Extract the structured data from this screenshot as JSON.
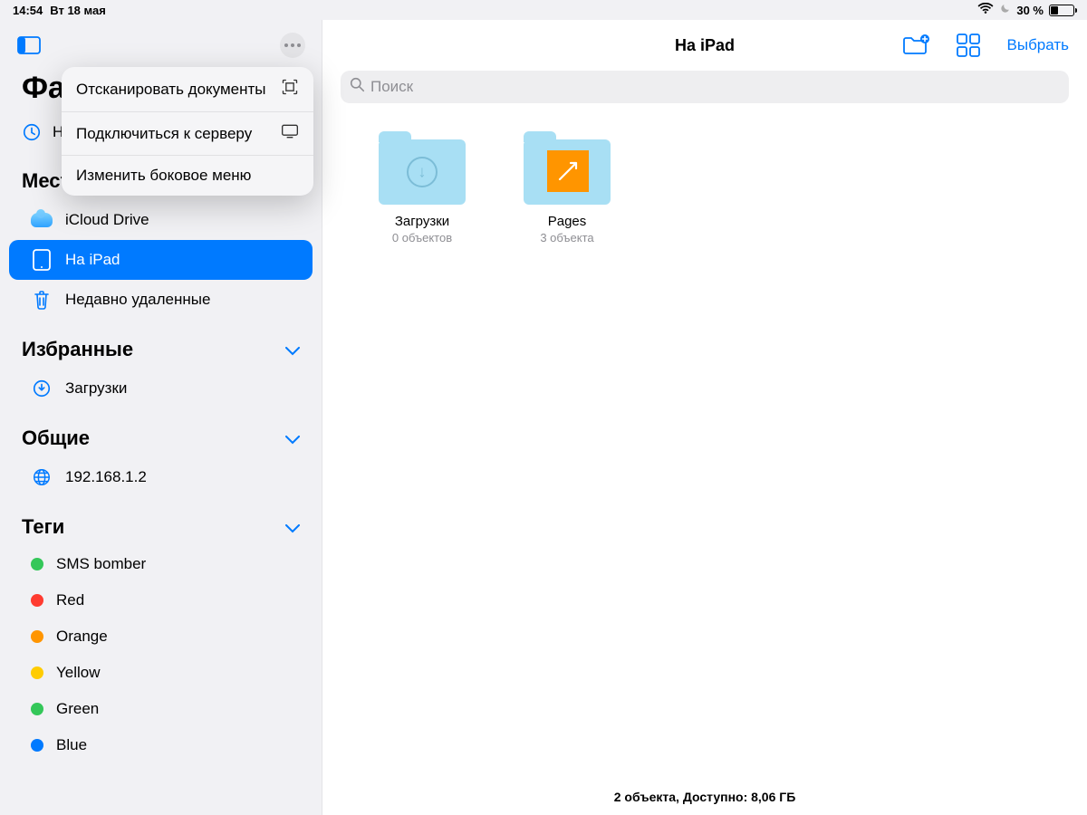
{
  "statusbar": {
    "time": "14:54",
    "date": "Вт 18 мая",
    "battery": "30 %"
  },
  "sidebar": {
    "title": "Файлы",
    "recent_label": "Недавние",
    "sections": {
      "places": {
        "title": "Места",
        "items": [
          {
            "label": "iCloud Drive"
          },
          {
            "label": "На iPad"
          },
          {
            "label": "Недавно удаленные"
          }
        ]
      },
      "favorites": {
        "title": "Избранные",
        "items": [
          {
            "label": "Загрузки"
          }
        ]
      },
      "shared": {
        "title": "Общие",
        "items": [
          {
            "label": "192.168.1.2"
          }
        ]
      },
      "tags": {
        "title": "Теги",
        "items": [
          {
            "label": "SMS bomber",
            "color": "#34c759"
          },
          {
            "label": "Red",
            "color": "#ff3b30"
          },
          {
            "label": "Orange",
            "color": "#ff9500"
          },
          {
            "label": "Yellow",
            "color": "#ffcc00"
          },
          {
            "label": "Green",
            "color": "#34c759"
          },
          {
            "label": "Blue",
            "color": "#007aff"
          }
        ]
      }
    }
  },
  "popover": {
    "items": [
      {
        "label": "Отсканировать документы"
      },
      {
        "label": "Подключиться к серверу"
      },
      {
        "label": "Изменить боковое меню"
      }
    ]
  },
  "main": {
    "title": "На iPad",
    "select_label": "Выбрать",
    "search_placeholder": "Поиск",
    "folders": [
      {
        "name": "Загрузки",
        "subtitle": "0 объектов",
        "kind": "downloads"
      },
      {
        "name": "Pages",
        "subtitle": "3 объекта",
        "kind": "pages"
      }
    ],
    "footer": "2 объекта, Доступно: 8,06 ГБ"
  }
}
